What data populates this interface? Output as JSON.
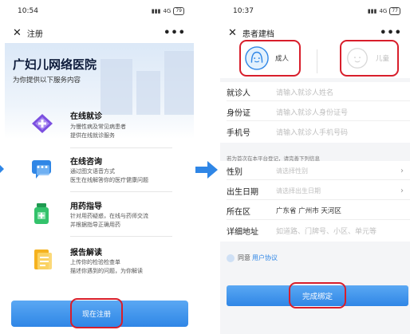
{
  "left": {
    "status": {
      "time": "10:54",
      "network": "4G",
      "battery": "79"
    },
    "nav": {
      "close": "✕",
      "title": "注册",
      "more": "•••"
    },
    "hero": {
      "title": "广妇儿网络医院",
      "subtitle": "为你提供以下服务内容"
    },
    "services": [
      {
        "title": "在线就诊",
        "desc1": "为慢性病及常见病患者",
        "desc2": "提供在线就诊服务",
        "icon": "diamond-plus-icon",
        "color": "#7b4fe0"
      },
      {
        "title": "在线咨询",
        "desc1": "通过图文语音方式",
        "desc2": "医生在线解答你的医疗健康问题",
        "icon": "chat-bubble-icon",
        "color": "#2f86e6"
      },
      {
        "title": "用药指导",
        "desc1": "针对用药疑惑，在线与药师交流",
        "desc2": "并根据指导正确用药",
        "icon": "medicine-bottle-icon",
        "color": "#33c26b"
      },
      {
        "title": "报告解读",
        "desc1": "上传你的检验检查单",
        "desc2": "描述你遇到的问题，为你解读",
        "icon": "report-document-icon",
        "color": "#f5b21f"
      }
    ],
    "register_button": "现在注册"
  },
  "right": {
    "status": {
      "time": "10:37",
      "network": "4G",
      "battery": "77"
    },
    "nav": {
      "close": "✕",
      "title": "患者建档",
      "more": "•••"
    },
    "tabs": {
      "adult": "成人",
      "child": "儿童"
    },
    "fields_top": [
      {
        "key": "就诊人",
        "placeholder": "请输入就诊人姓名"
      },
      {
        "key": "身份证",
        "placeholder": "请输入就诊人身份证号"
      },
      {
        "key": "手机号",
        "placeholder": "请输入就诊人手机号码"
      }
    ],
    "note": "若为首次在本平台登记，请完善下列信息",
    "fields_bottom": [
      {
        "key": "性别",
        "value": "请选择性别",
        "filled": false,
        "chevron": "›"
      },
      {
        "key": "出生日期",
        "value": "请选择出生日期",
        "filled": false,
        "chevron": "›"
      },
      {
        "key": "所在区",
        "value": "广东省 广州市 天河区",
        "filled": true,
        "chevron": ""
      },
      {
        "key": "详细地址",
        "value": "如道路、门牌号、小区、单元等",
        "filled": false,
        "chevron": ""
      }
    ],
    "agree": {
      "prefix": "同意",
      "link": "用户协议"
    },
    "bind_button": "完成绑定"
  },
  "colors": {
    "primary": "#2f86e6",
    "highlight": "#d81e2b"
  }
}
